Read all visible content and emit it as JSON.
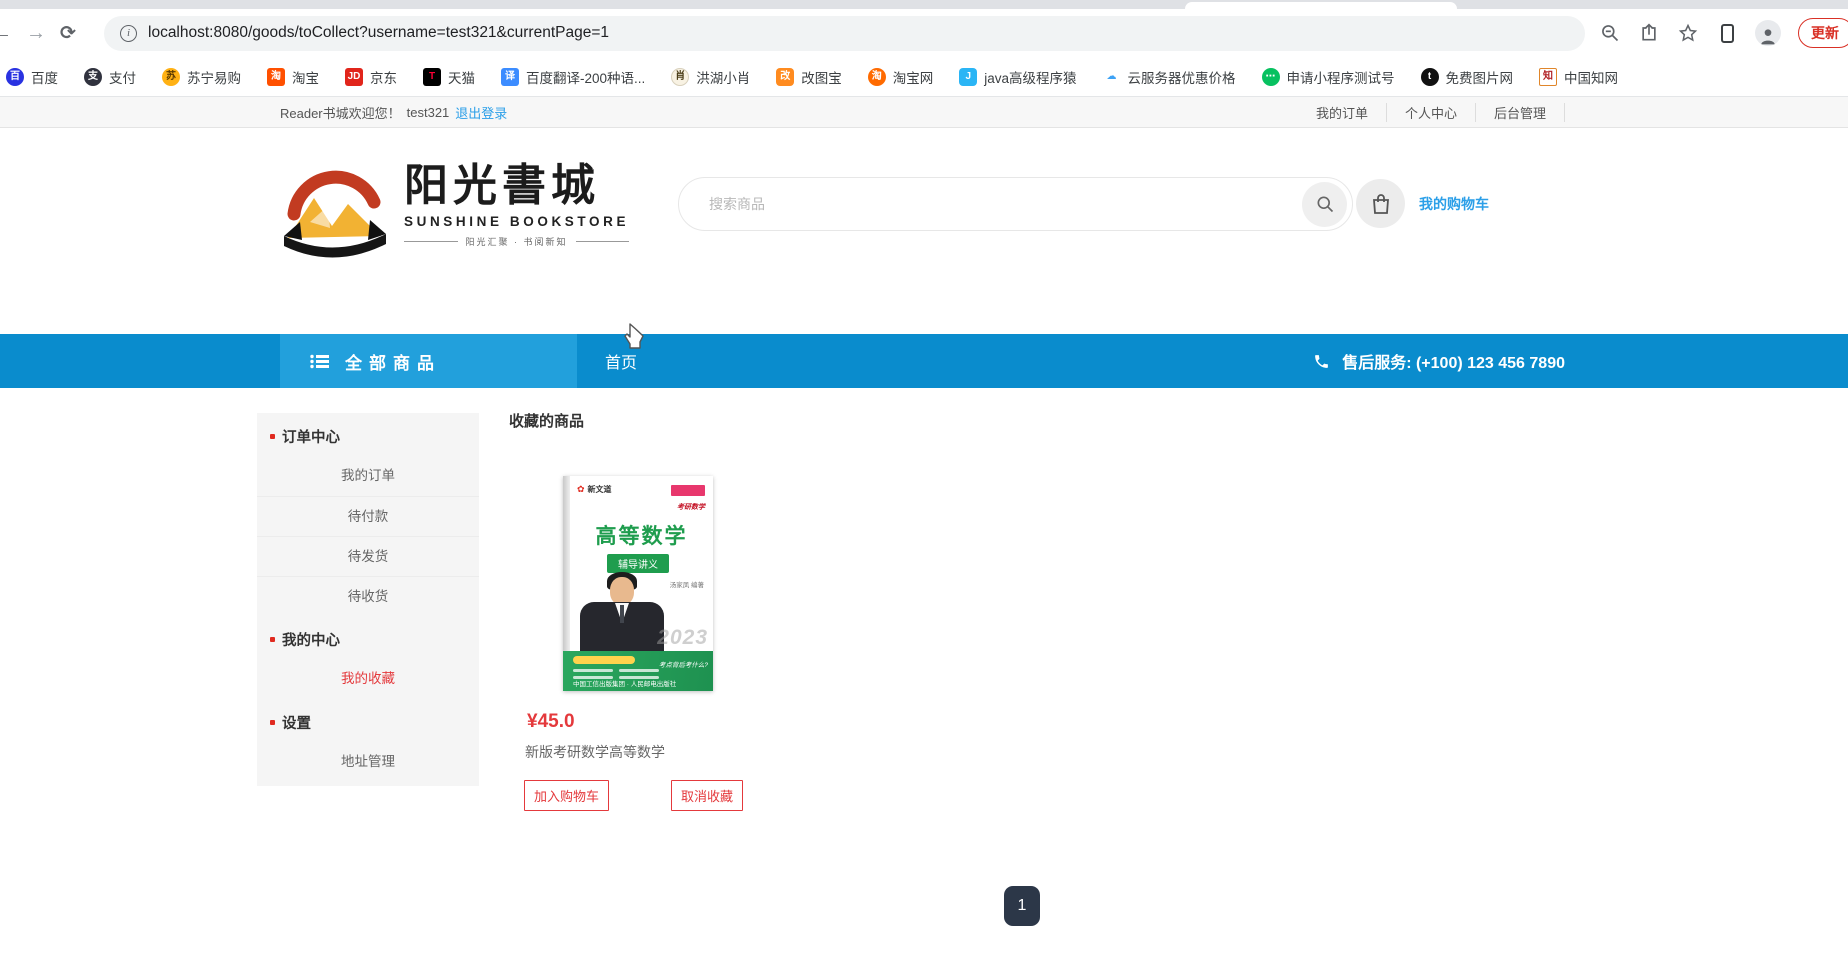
{
  "browser": {
    "url": "localhost:8080/goods/toCollect?username=test321&currentPage=1",
    "update_label": "更新",
    "bookmarks": [
      {
        "label": "百度",
        "glyph": "百",
        "bg": "#2932e1",
        "fg": "#ffffff",
        "radius": "50%",
        "border": "none"
      },
      {
        "label": "支付",
        "glyph": "支",
        "bg": "#30323e",
        "fg": "#ffffff",
        "radius": "50%",
        "border": "none"
      },
      {
        "label": "苏宁易购",
        "glyph": "苏",
        "bg": "#ffb114",
        "fg": "#5b3a00",
        "radius": "50%",
        "border": "none"
      },
      {
        "label": "淘宝",
        "glyph": "淘",
        "bg": "#ff5000",
        "fg": "#ffffff",
        "radius": "3px",
        "border": "none"
      },
      {
        "label": "京东",
        "glyph": "JD",
        "bg": "#e1251b",
        "fg": "#ffffff",
        "radius": "3px",
        "border": "none"
      },
      {
        "label": "天猫",
        "glyph": "T",
        "bg": "#000000",
        "fg": "#ff0036",
        "radius": "3px",
        "border": "none"
      },
      {
        "label": "百度翻译-200种语...",
        "glyph": "译",
        "bg": "#3c8cff",
        "fg": "#ffffff",
        "radius": "3px",
        "border": "none"
      },
      {
        "label": "洪湖小肖",
        "glyph": "肖",
        "bg": "#f8f2e3",
        "fg": "#4a3d18",
        "radius": "50%",
        "border": "1px solid #d8d0bc"
      },
      {
        "label": "改图宝",
        "glyph": "改",
        "bg": "#ff8b1f",
        "fg": "#ffffff",
        "radius": "4px",
        "border": "none"
      },
      {
        "label": "淘宝网",
        "glyph": "淘",
        "bg": "#ff6a00",
        "fg": "#ffffff",
        "radius": "50%",
        "border": "none"
      },
      {
        "label": "java高级程序猿",
        "glyph": "J",
        "bg": "#2ab5f5",
        "fg": "#ffffff",
        "radius": "4px",
        "border": "none"
      },
      {
        "label": "云服务器优惠价格",
        "glyph": "☁",
        "bg": "#ffffff",
        "fg": "#3da2f5",
        "radius": "50%",
        "border": "none"
      },
      {
        "label": "申请小程序测试号",
        "glyph": "⋯",
        "bg": "#07c160",
        "fg": "#ffffff",
        "radius": "50%",
        "border": "none"
      },
      {
        "label": "免费图片网",
        "glyph": "t",
        "bg": "#111111",
        "fg": "#ffffff",
        "radius": "50%",
        "border": "none"
      },
      {
        "label": "中国知网",
        "glyph": "知",
        "bg": "#ffffff",
        "fg": "#b01f24",
        "radius": "2px",
        "border": "1px solid #e0862a"
      }
    ]
  },
  "utility": {
    "welcome": "Reader书城欢迎您！",
    "username": "test321",
    "logout": "退出登录",
    "links": [
      {
        "label": "我的订单"
      },
      {
        "label": "个人中心"
      },
      {
        "label": "后台管理"
      }
    ]
  },
  "header": {
    "logo": {
      "cn": "阳光書城",
      "en": "SUNSHINE BOOKSTORE",
      "tagline": "阳光汇聚 · 书阅新知"
    },
    "search": {
      "placeholder": "搜索商品"
    },
    "cart": {
      "label": "我的购物车"
    }
  },
  "nav": {
    "all_goods": "全部商品",
    "home": "首页",
    "service": "售后服务: (+100) 123 456 7890"
  },
  "sidebar": {
    "sections": [
      {
        "title": "订单中心",
        "items": [
          {
            "label": "我的订单"
          },
          {
            "label": "待付款"
          },
          {
            "label": "待发货"
          },
          {
            "label": "待收货"
          }
        ]
      },
      {
        "title": "我的中心",
        "items": [
          {
            "label": "我的收藏"
          }
        ]
      },
      {
        "title": "设置",
        "items": [
          {
            "label": "地址管理"
          }
        ]
      }
    ]
  },
  "main": {
    "title": "收藏的商品",
    "product": {
      "price": "¥45.0",
      "name": "新版考研数学高等数学",
      "add_cart_label": "加入购物车",
      "cancel_collect_label": "取消收藏",
      "cover": {
        "brand": "新文道",
        "badge": "考研数学",
        "title": "高等数学",
        "subtitle": "辅导讲义",
        "author": "汤家凤 编著",
        "year": "2023",
        "band_note": "考点背后考什么?",
        "publisher": "中国工信出版集团 · 人民邮电出版社"
      }
    },
    "pagination": {
      "page": "1"
    }
  },
  "colors": {
    "nav_blue": "#0a8ccd",
    "nav_blue_light": "#22a0dc",
    "link_blue": "#2b9fe8",
    "price_red": "#e4393c",
    "pagination_dark": "#2c3748"
  }
}
